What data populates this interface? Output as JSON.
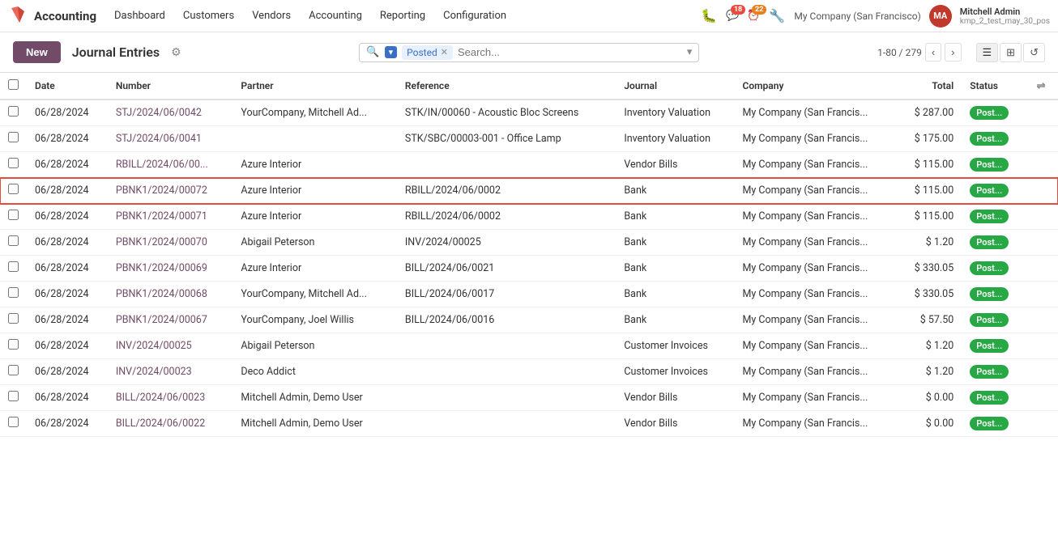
{
  "topnav": {
    "brand": "Accounting",
    "menu_items": [
      "Dashboard",
      "Customers",
      "Vendors",
      "Accounting",
      "Reporting",
      "Configuration"
    ],
    "badge_messages": "18",
    "badge_clock": "22",
    "company": "My Company (San Francisco)",
    "user_name": "Mitchell Admin",
    "user_sub": "kmp_2_test_may_30_pos",
    "user_initials": "MA"
  },
  "toolbar": {
    "new_label": "New",
    "page_title": "Journal Entries",
    "filter_label": "Posted",
    "search_placeholder": "Search...",
    "pagination": "1-80 / 279"
  },
  "table": {
    "columns": [
      "",
      "Date",
      "Number",
      "Partner",
      "Reference",
      "Journal",
      "Company",
      "Total",
      "Status",
      ""
    ],
    "rows": [
      {
        "date": "06/28/2024",
        "number": "STJ/2024/06/0042",
        "partner": "YourCompany, Mitchell Ad...",
        "reference": "STK/IN/00060 - Acoustic Bloc Screens",
        "journal": "Inventory Valuation",
        "company": "My Company (San Francis...",
        "total": "$ 287.00",
        "status": "Post...",
        "highlighted": false
      },
      {
        "date": "06/28/2024",
        "number": "STJ/2024/06/0041",
        "partner": "",
        "reference": "STK/SBC/00003-001 - Office Lamp",
        "journal": "Inventory Valuation",
        "company": "My Company (San Francis...",
        "total": "$ 175.00",
        "status": "Post...",
        "highlighted": false
      },
      {
        "date": "06/28/2024",
        "number": "RBILL/2024/06/00...",
        "partner": "Azure Interior",
        "reference": "",
        "journal": "Vendor Bills",
        "company": "My Company (San Francis...",
        "total": "$ 115.00",
        "status": "Post...",
        "highlighted": false
      },
      {
        "date": "06/28/2024",
        "number": "PBNK1/2024/00072",
        "partner": "Azure Interior",
        "reference": "RBILL/2024/06/0002",
        "journal": "Bank",
        "company": "My Company (San Francis...",
        "total": "$ 115.00",
        "status": "Post...",
        "highlighted": true
      },
      {
        "date": "06/28/2024",
        "number": "PBNK1/2024/00071",
        "partner": "Azure Interior",
        "reference": "RBILL/2024/06/0002",
        "journal": "Bank",
        "company": "My Company (San Francis...",
        "total": "$ 115.00",
        "status": "Post...",
        "highlighted": false
      },
      {
        "date": "06/28/2024",
        "number": "PBNK1/2024/00070",
        "partner": "Abigail Peterson",
        "reference": "INV/2024/00025",
        "journal": "Bank",
        "company": "My Company (San Francis...",
        "total": "$ 1.20",
        "status": "Post...",
        "highlighted": false
      },
      {
        "date": "06/28/2024",
        "number": "PBNK1/2024/00069",
        "partner": "Azure Interior",
        "reference": "BILL/2024/06/0021",
        "journal": "Bank",
        "company": "My Company (San Francis...",
        "total": "$ 330.05",
        "status": "Post...",
        "highlighted": false
      },
      {
        "date": "06/28/2024",
        "number": "PBNK1/2024/00068",
        "partner": "YourCompany, Mitchell Ad...",
        "reference": "BILL/2024/06/0017",
        "journal": "Bank",
        "company": "My Company (San Francis...",
        "total": "$ 330.05",
        "status": "Post...",
        "highlighted": false
      },
      {
        "date": "06/28/2024",
        "number": "PBNK1/2024/00067",
        "partner": "YourCompany, Joel Willis",
        "reference": "BILL/2024/06/0016",
        "journal": "Bank",
        "company": "My Company (San Francis...",
        "total": "$ 57.50",
        "status": "Post...",
        "highlighted": false
      },
      {
        "date": "06/28/2024",
        "number": "INV/2024/00025",
        "partner": "Abigail Peterson",
        "reference": "",
        "journal": "Customer Invoices",
        "company": "My Company (San Francis...",
        "total": "$ 1.20",
        "status": "Post...",
        "highlighted": false
      },
      {
        "date": "06/28/2024",
        "number": "INV/2024/00023",
        "partner": "Deco Addict",
        "reference": "",
        "journal": "Customer Invoices",
        "company": "My Company (San Francis...",
        "total": "$ 1.20",
        "status": "Post...",
        "highlighted": false
      },
      {
        "date": "06/28/2024",
        "number": "BILL/2024/06/0023",
        "partner": "Mitchell Admin, Demo User",
        "reference": "",
        "journal": "Vendor Bills",
        "company": "My Company (San Francis...",
        "total": "$ 0.00",
        "status": "Post...",
        "highlighted": false
      },
      {
        "date": "06/28/2024",
        "number": "BILL/2024/06/0022",
        "partner": "Mitchell Admin, Demo User",
        "reference": "",
        "journal": "Vendor Bills",
        "company": "My Company (San Francis...",
        "total": "$ 0.00",
        "status": "Post...",
        "highlighted": false
      }
    ]
  }
}
